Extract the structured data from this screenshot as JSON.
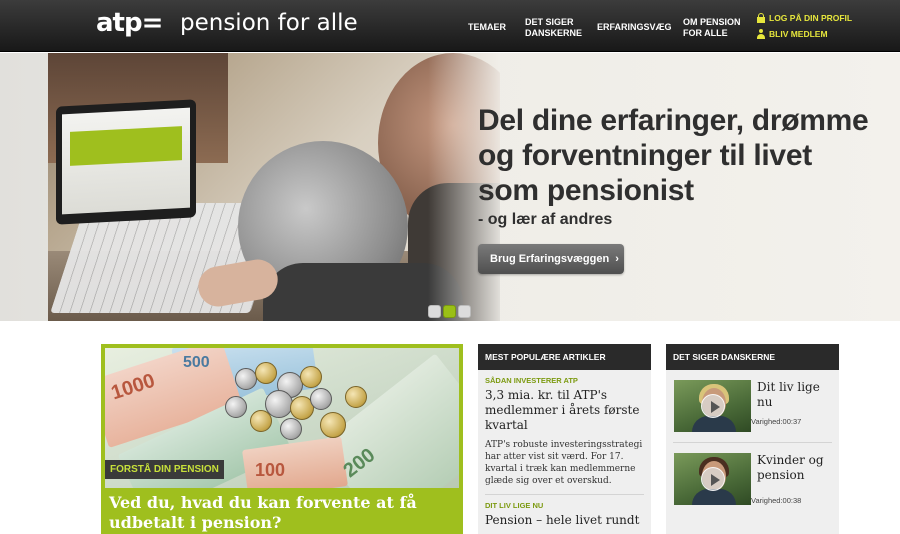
{
  "header": {
    "logo": "atp=",
    "tagline": "pension for alle",
    "nav": [
      {
        "label": "TEMAER"
      },
      {
        "label": "DET SIGER DANSKERNE"
      },
      {
        "label": "ERFARINGSVÆG"
      },
      {
        "label": "OM PENSION FOR ALLE"
      }
    ],
    "utility": {
      "login": "LOG PÅ DIN PROFIL",
      "login_icon": "lock-icon",
      "join": "BLIV MEDLEM",
      "join_icon": "person-icon"
    }
  },
  "hero": {
    "title": "Del dine erfaringer, drømme og forventninger til livet som pensionist",
    "subtitle": "- og lær af andres",
    "button_label": "Brug Erfaringsvæggen",
    "button_arrow": "›",
    "slides": 3,
    "active_slide": 2
  },
  "feature": {
    "tag": "FORSTÅ DIN PENSION",
    "title": "Ved du, hvad du kan forvente at få udbetalt i pension?",
    "note_labels": [
      "1000",
      "500",
      "200",
      "100"
    ]
  },
  "popular": {
    "heading": "MEST POPULÆRE ARTIKLER",
    "articles": [
      {
        "kicker": "SÅDAN INVESTERER ATP",
        "title": "3,3 mia. kr. til ATP's medlemmer i årets første kvartal",
        "teaser": "ATP's robuste investeringsstrategi har atter vist sit værd. For 17. kvartal i træk kan medlemmerne glæde sig over et overskud."
      },
      {
        "kicker": "DIT LIV LIGE NU",
        "title": "Pension – hele livet rundt"
      }
    ]
  },
  "videos": {
    "heading": "DET SIGER DANSKERNE",
    "items": [
      {
        "title": "Dit liv lige nu",
        "duration": "Varighed:00:37"
      },
      {
        "title": "Kvinder og pension",
        "duration": "Varighed:00:38"
      }
    ]
  },
  "colors": {
    "accent_green": "#9fbf1e",
    "header_dark": "#2a2a2a",
    "utility_yellow": "#e6e63c"
  }
}
